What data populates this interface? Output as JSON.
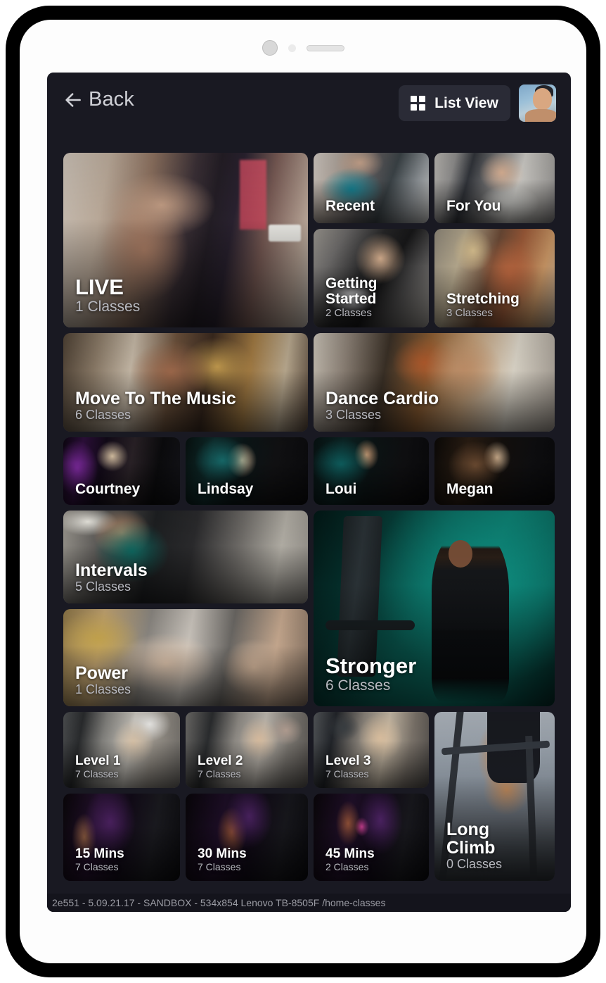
{
  "device": {
    "camera_icon": "camera-lens-icon",
    "sensor_icon": "proximity-sensor-icon",
    "speaker_icon": "speaker-slot-icon"
  },
  "header": {
    "back_icon": "arrow-left-icon",
    "back_label": "Back",
    "grid_icon": "grid-view-icon",
    "list_view_label": "List View",
    "avatar_icon": "user-avatar"
  },
  "cards": [
    {
      "id": "live",
      "title": "LIVE",
      "subtitle": "1 Classes"
    },
    {
      "id": "recent",
      "title": "Recent",
      "subtitle": ""
    },
    {
      "id": "for-you",
      "title": "For You",
      "subtitle": ""
    },
    {
      "id": "getting-started",
      "title": "Getting\nStarted",
      "subtitle": "2 Classes"
    },
    {
      "id": "stretching",
      "title": "Stretching",
      "subtitle": "3 Classes"
    },
    {
      "id": "move-to-the-music",
      "title": "Move To The Music",
      "subtitle": "6 Classes"
    },
    {
      "id": "dance-cardio",
      "title": "Dance Cardio",
      "subtitle": "3 Classes"
    },
    {
      "id": "courtney",
      "title": "Courtney",
      "subtitle": ""
    },
    {
      "id": "lindsay",
      "title": "Lindsay",
      "subtitle": ""
    },
    {
      "id": "loui",
      "title": "Loui",
      "subtitle": ""
    },
    {
      "id": "megan",
      "title": "Megan",
      "subtitle": ""
    },
    {
      "id": "intervals",
      "title": "Intervals",
      "subtitle": "5 Classes"
    },
    {
      "id": "power",
      "title": "Power",
      "subtitle": "1 Classes"
    },
    {
      "id": "stronger",
      "title": "Stronger",
      "subtitle": "6 Classes"
    },
    {
      "id": "level-1",
      "title": "Level 1",
      "subtitle": "7 Classes"
    },
    {
      "id": "level-2",
      "title": "Level 2",
      "subtitle": "7 Classes"
    },
    {
      "id": "level-3",
      "title": "Level 3",
      "subtitle": "7 Classes"
    },
    {
      "id": "long-climb",
      "title": "Long\nClimb",
      "subtitle": "0 Classes"
    },
    {
      "id": "15-mins",
      "title": "15 Mins",
      "subtitle": "7 Classes"
    },
    {
      "id": "30-mins",
      "title": "30 Mins",
      "subtitle": "7 Classes"
    },
    {
      "id": "45-mins",
      "title": "45 Mins",
      "subtitle": "2 Classes"
    }
  ],
  "status_bar": {
    "text": "2e551 - 5.09.21.17 - SANDBOX - 534x854 Lenovo TB-8505F /home-classes"
  },
  "colors": {
    "app_background": "#191922",
    "card_placeholder": "#20212b",
    "button_background": "#2a2b36",
    "accent_teal": "#0c7a6c",
    "text_primary": "#ffffff",
    "text_secondary": "#b9bac1",
    "status_background": "#14141c",
    "status_text": "#9b9ca4",
    "device_bezel": "#000000",
    "device_body": "#fdfdfd"
  }
}
